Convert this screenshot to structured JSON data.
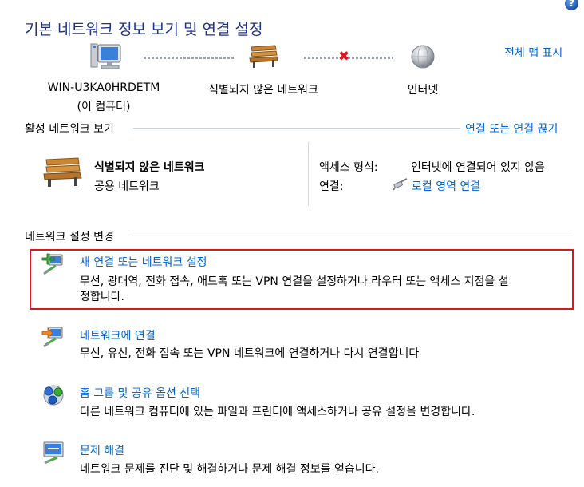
{
  "title": "기본 네트워크 정보 보기 및 연결 설정",
  "help_glyph": "?",
  "map": {
    "full_map_link": "전체 맵 표시",
    "computer_name": "WIN-U3KA0HRDETM",
    "computer_sub": "(이 컴퓨터)",
    "network_name": "식별되지 않은 네트워크",
    "internet_name": "인터넷",
    "broken_mark": "✖"
  },
  "active": {
    "header": "활성 네트워크 보기",
    "connect_link": "연결 또는 연결 끊기",
    "network_name": "식별되지 않은 네트워크",
    "network_type": "공용 네트워크",
    "access_label": "액세스 형식:",
    "access_value": "인터넷에 연결되어 있지 않음",
    "conn_label": "연결:",
    "conn_value": "로컬 영역 연결"
  },
  "settings": {
    "header": "네트워크 설정 변경",
    "tasks": [
      {
        "title": "새 연결 또는 네트워크 설정",
        "desc_line1": "무선, 광대역, 전화 접속, 애드혹 또는 VPN 연결을 설정하거나 라우터 또는 액세스 지점을 설",
        "desc_line2": "정합니다."
      },
      {
        "title": "네트워크에 연결",
        "desc": "무선, 유선, 전화 접속 또는 VPN 네트워크에 연결하거나 다시 연결합니다"
      },
      {
        "title": "홈 그룹 및 공유 옵션 선택",
        "desc": "다른 네트워크 컴퓨터에 있는 파일과 프린터에 액세스하거나 공유 설정을 변경합니다."
      },
      {
        "title": "문제 해결",
        "desc": "네트워크 문제를 진단 및 해결하거나 문제 해결 정보를 얻습니다."
      }
    ]
  },
  "colors": {
    "title": "#1e3287",
    "link": "#0066cc",
    "highlight": "#d8191f"
  }
}
